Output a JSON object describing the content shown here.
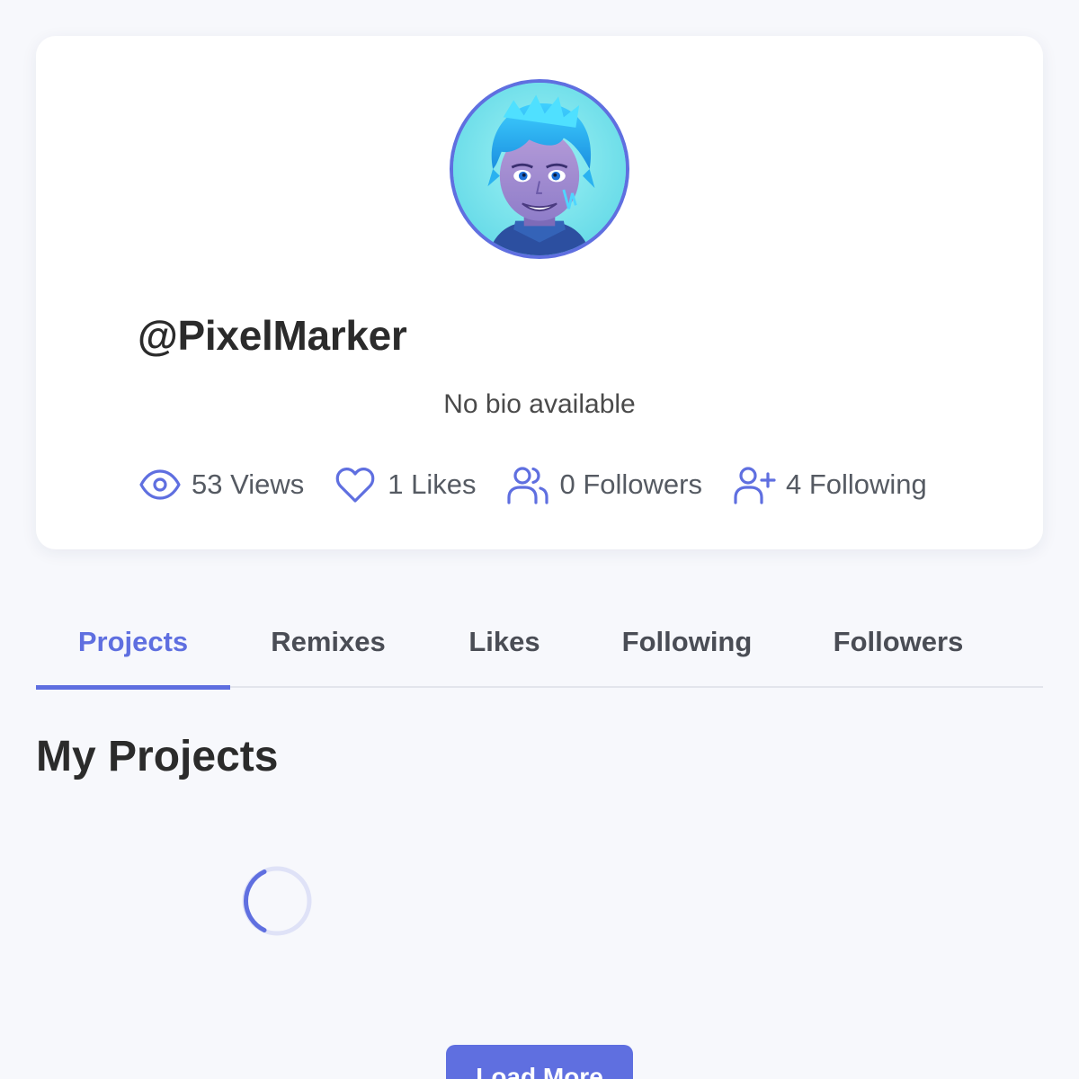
{
  "profile": {
    "username": "@PixelMarker",
    "bio": "No bio available",
    "avatar_icon": "user-avatar-anime-portrait",
    "stats": [
      {
        "icon": "eye-icon",
        "label": "53 Views"
      },
      {
        "icon": "heart-icon",
        "label": "1 Likes"
      },
      {
        "icon": "users-icon",
        "label": "0 Followers"
      },
      {
        "icon": "user-plus-icon",
        "label": "4 Following"
      }
    ]
  },
  "tabs": [
    {
      "label": "Projects",
      "active": true
    },
    {
      "label": "Remixes",
      "active": false
    },
    {
      "label": "Likes",
      "active": false
    },
    {
      "label": "Following",
      "active": false
    },
    {
      "label": "Followers",
      "active": false
    }
  ],
  "section": {
    "title": "My Projects",
    "loading_icon": "loading-spinner"
  },
  "load_more": {
    "label": "Load More"
  },
  "colors": {
    "accent": "#5f6fe0",
    "background": "#f7f8fc",
    "card": "#ffffff",
    "text": "#2b2b2b",
    "muted": "#555a62"
  }
}
